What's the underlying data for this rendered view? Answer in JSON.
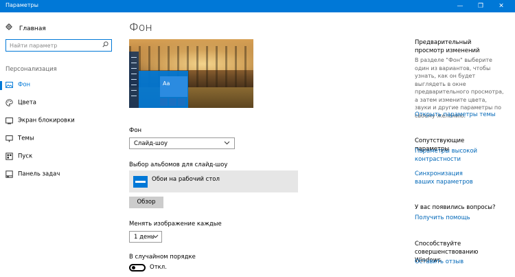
{
  "window": {
    "title": "Параметры",
    "minimize": "—",
    "maximize": "❐",
    "close": "✕"
  },
  "sidebar": {
    "home_label": "Главная",
    "search_placeholder": "Найти параметр",
    "section_label": "Персонализация",
    "items": [
      {
        "label": "Фон",
        "icon": "picture-icon",
        "active": true
      },
      {
        "label": "Цвета",
        "icon": "palette-icon",
        "active": false
      },
      {
        "label": "Экран блокировки",
        "icon": "lock-screen-icon",
        "active": false
      },
      {
        "label": "Темы",
        "icon": "brush-icon",
        "active": false
      },
      {
        "label": "Пуск",
        "icon": "start-icon",
        "active": false
      },
      {
        "label": "Панель задач",
        "icon": "taskbar-icon",
        "active": false
      }
    ]
  },
  "main": {
    "title": "Фон",
    "preview_tile_text": "Aa",
    "background_label": "Фон",
    "background_value": "Слайд-шоу",
    "album_label": "Выбор альбомов для слайд-шоу",
    "album_name": "Обои на рабочий стол",
    "browse_button": "Обзор",
    "interval_label": "Менять изображение каждые",
    "interval_value": "1 день",
    "shuffle_label": "В случайном порядке",
    "shuffle_state": "Откл."
  },
  "right": {
    "preview_title": "Предварительный просмотр изменений",
    "preview_text": "В разделе \"Фон\" выберите один из вариантов, чтобы узнать, как он будет выглядеть в окне предварительного просмотра, а затем измените цвета, звуки и другие параметры по своему желанию.",
    "theme_link": "Открыть параметры темы",
    "related_title": "Сопутствующие параметры",
    "contrast_link": "Параметры высокой контрастности",
    "sync_link": "Синхронизация ваших параметров",
    "questions_title": "У вас появились вопросы?",
    "help_link": "Получить помощь",
    "improve_title": "Способствуйте совершенствованию Windows",
    "feedback_link": "Оставить отзыв"
  },
  "colors": {
    "accent": "#0078d7",
    "link": "#0067b8"
  }
}
